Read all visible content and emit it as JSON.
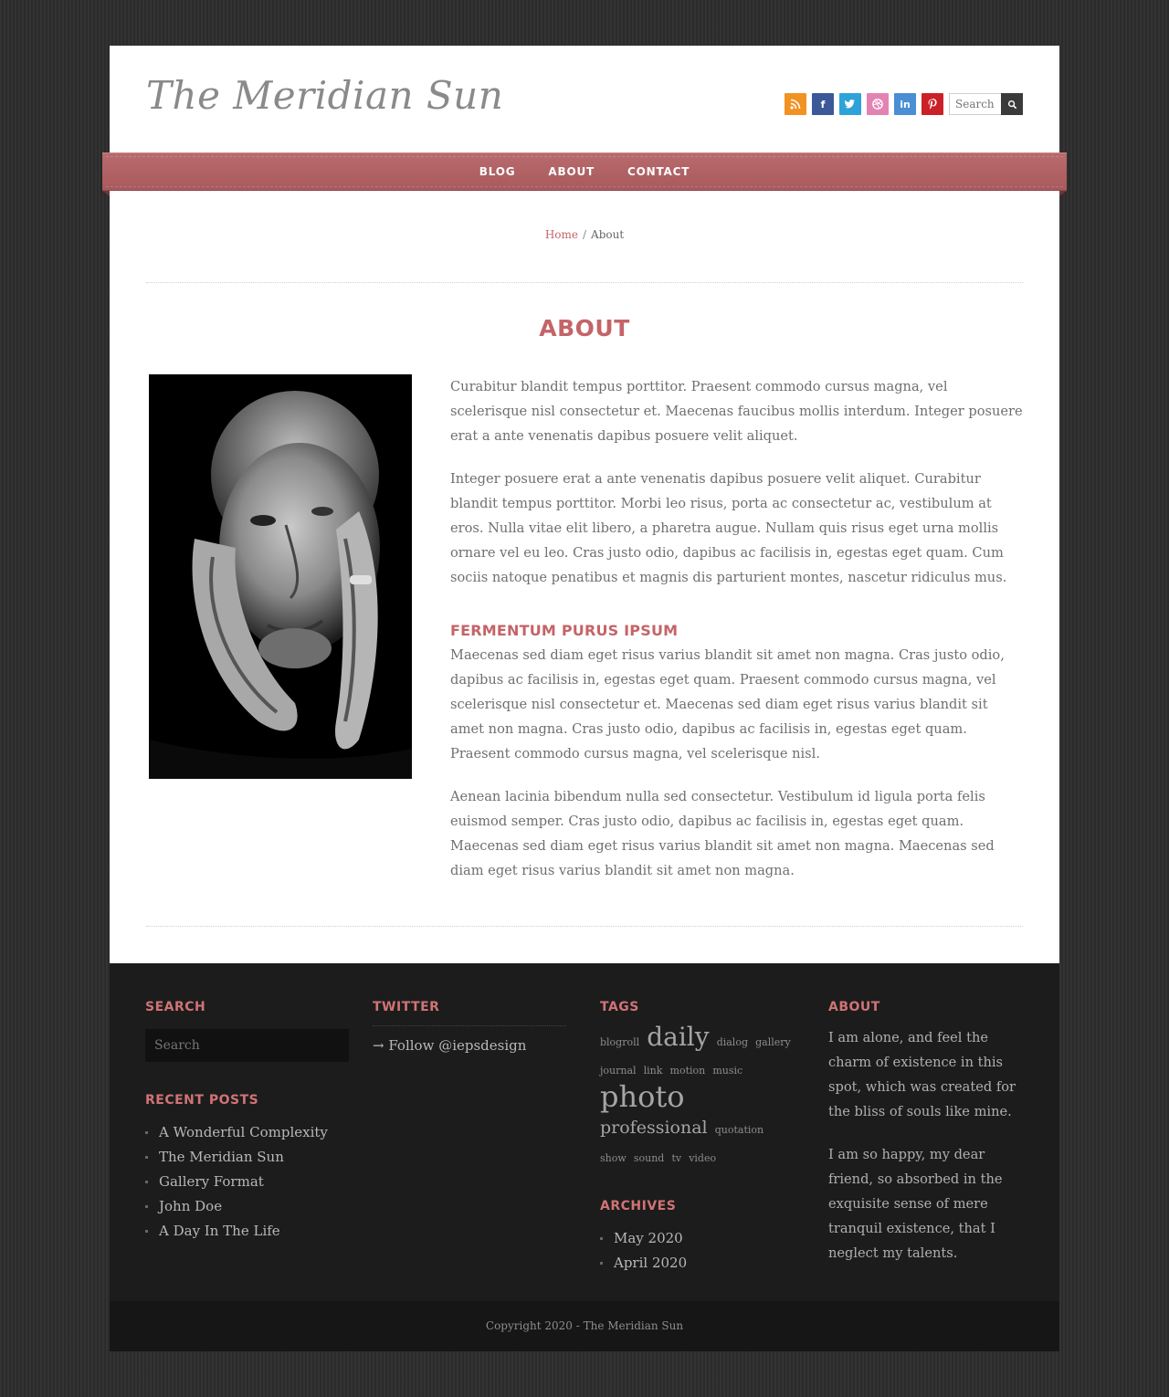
{
  "site": {
    "title": "The Meridian Sun"
  },
  "header": {
    "social": [
      "rss-icon",
      "facebook-icon",
      "twitter-icon",
      "dribbble-icon",
      "linkedin-icon",
      "pinterest-icon"
    ],
    "social_colors": {
      "rss": "#f29223",
      "facebook": "#3b5998",
      "twitter": "#2ea3d9",
      "dribbble": "#e283b3",
      "linkedin": "#4a8fd4",
      "pinterest": "#cb2027"
    },
    "search_placeholder": "Search"
  },
  "nav": {
    "items": [
      "BLOG",
      "ABOUT",
      "CONTACT"
    ],
    "accent": "#b06366"
  },
  "breadcrumb": {
    "home": "Home",
    "separator": "/",
    "current": "About"
  },
  "main": {
    "title": "ABOUT",
    "paragraphs": [
      "Curabitur blandit tempus porttitor. Praesent commodo cursus magna, vel scelerisque nisl consectetur et. Maecenas faucibus mollis interdum. Integer posuere erat a ante venenatis dapibus posuere velit aliquet.",
      "Integer posuere erat a ante venenatis dapibus posuere velit aliquet. Curabitur blandit tempus porttitor. Morbi leo risus, porta ac consectetur ac, vestibulum at eros. Nulla vitae elit libero, a pharetra augue. Nullam quis risus eget urna mollis ornare vel eu leo. Cras justo odio, dapibus ac facilisis in, egestas eget quam. Cum sociis natoque penatibus et magnis dis parturient montes, nascetur ridiculus mus."
    ],
    "subheading": "FERMENTUM PURUS IPSUM",
    "paragraphs2": [
      "Maecenas sed diam eget risus varius blandit sit amet non magna. Cras justo odio, dapibus ac facilisis in, egestas eget quam. Praesent commodo cursus magna, vel scelerisque nisl consectetur et. Maecenas sed diam eget risus varius blandit sit amet non magna. Cras justo odio, dapibus ac facilisis in, egestas eget quam. Praesent commodo cursus magna, vel scelerisque nisl.",
      "Aenean lacinia bibendum nulla sed consectetur. Vestibulum id ligula porta felis euismod semper. Cras justo odio, dapibus ac facilisis in, egestas eget quam. Maecenas sed diam eget risus varius blandit sit amet non magna. Maecenas sed diam eget risus varius blandit sit amet non magna."
    ]
  },
  "footer": {
    "search": {
      "heading": "SEARCH",
      "placeholder": "Search"
    },
    "recent": {
      "heading": "RECENT POSTS",
      "items": [
        "A Wonderful Complexity",
        "The Meridian Sun",
        "Gallery Format",
        "John Doe",
        "A Day In The Life"
      ]
    },
    "twitter": {
      "heading": "TWITTER",
      "follow": "→ Follow @iepsdesign"
    },
    "tags": {
      "heading": "TAGS",
      "items": [
        {
          "label": "blogroll",
          "size": 11
        },
        {
          "label": "daily",
          "size": 28
        },
        {
          "label": "dialog",
          "size": 11
        },
        {
          "label": "gallery",
          "size": 11
        },
        {
          "label": "journal",
          "size": 11
        },
        {
          "label": "link",
          "size": 11
        },
        {
          "label": "motion",
          "size": 11
        },
        {
          "label": "music",
          "size": 11
        },
        {
          "label": "photo",
          "size": 32
        },
        {
          "label": "professional",
          "size": 19
        },
        {
          "label": "quotation",
          "size": 11
        },
        {
          "label": "show",
          "size": 11
        },
        {
          "label": "sound",
          "size": 11
        },
        {
          "label": "tv",
          "size": 11
        },
        {
          "label": "video",
          "size": 11
        }
      ]
    },
    "archives": {
      "heading": "ARCHIVES",
      "items": [
        "May 2020",
        "April 2020"
      ]
    },
    "about": {
      "heading": "ABOUT",
      "paragraphs": [
        "I am alone, and feel the charm of existence in this spot, which was created for the bliss of souls like mine.",
        "I am so happy, my dear friend, so absorbed in the exquisite sense of mere tranquil existence, that I neglect my talents."
      ]
    },
    "copyright": "Copyright 2020 - The Meridian Sun"
  }
}
